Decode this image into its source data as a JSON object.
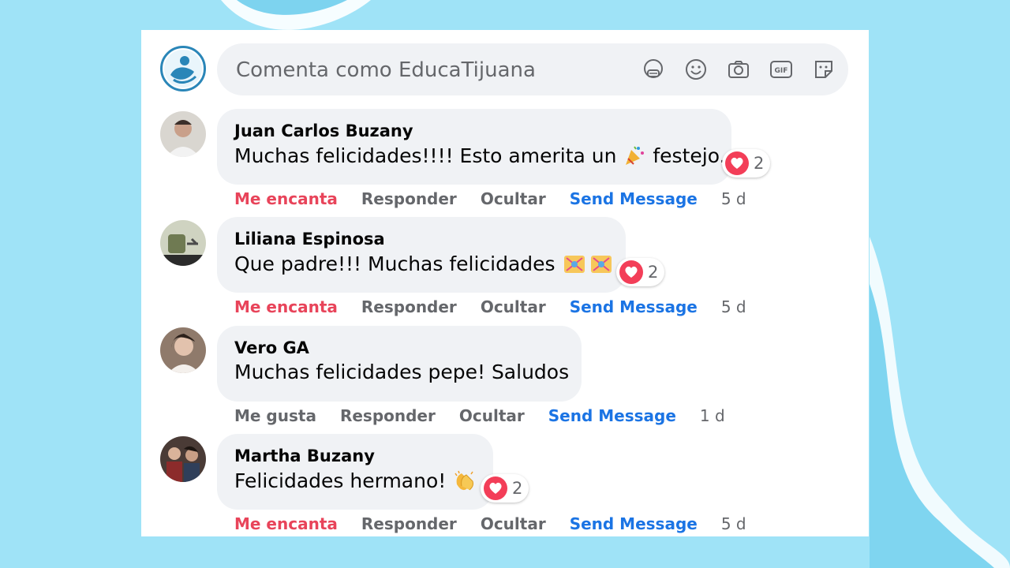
{
  "composer": {
    "placeholder": "Comenta como EducaTijuana",
    "icons": [
      "avatar-sticker-icon",
      "emoji-icon",
      "camera-icon",
      "gif-icon",
      "sticker-icon"
    ]
  },
  "comments": [
    {
      "author": "Juan Carlos Buzany",
      "text_before": "Muchas felicidades!!!! Esto amerita un",
      "text_after": "festejo.",
      "reaction_count": "2",
      "actions": {
        "react": "Me encanta",
        "reply": "Responder",
        "hide": "Ocultar",
        "message": "Send Message",
        "time": "5 d"
      }
    },
    {
      "author": "Liliana Espinosa",
      "text_before": "Que padre!!! Muchas felicidades",
      "text_after": "",
      "reaction_count": "2",
      "actions": {
        "react": "Me encanta",
        "reply": "Responder",
        "hide": "Ocultar",
        "message": "Send Message",
        "time": "5 d"
      }
    },
    {
      "author": "Vero GA",
      "text_before": "Muchas felicidades pepe! Saludos",
      "text_after": "",
      "reaction_count": "",
      "actions": {
        "react": "Me gusta",
        "reply": "Responder",
        "hide": "Ocultar",
        "message": "Send Message",
        "time": "1 d"
      }
    },
    {
      "author": "Martha Buzany",
      "text_before": "Felicidades hermano!",
      "text_after": "",
      "reaction_count": "2",
      "actions": {
        "react": "Me encanta",
        "reply": "Responder",
        "hide": "Ocultar",
        "message": "Send Message",
        "time": "5 d"
      }
    }
  ],
  "colors": {
    "background": "#9fe3f7",
    "bubble": "#f0f2f5",
    "love_red": "#e8445a",
    "link_blue": "#1b74e4",
    "muted": "#65676b"
  }
}
